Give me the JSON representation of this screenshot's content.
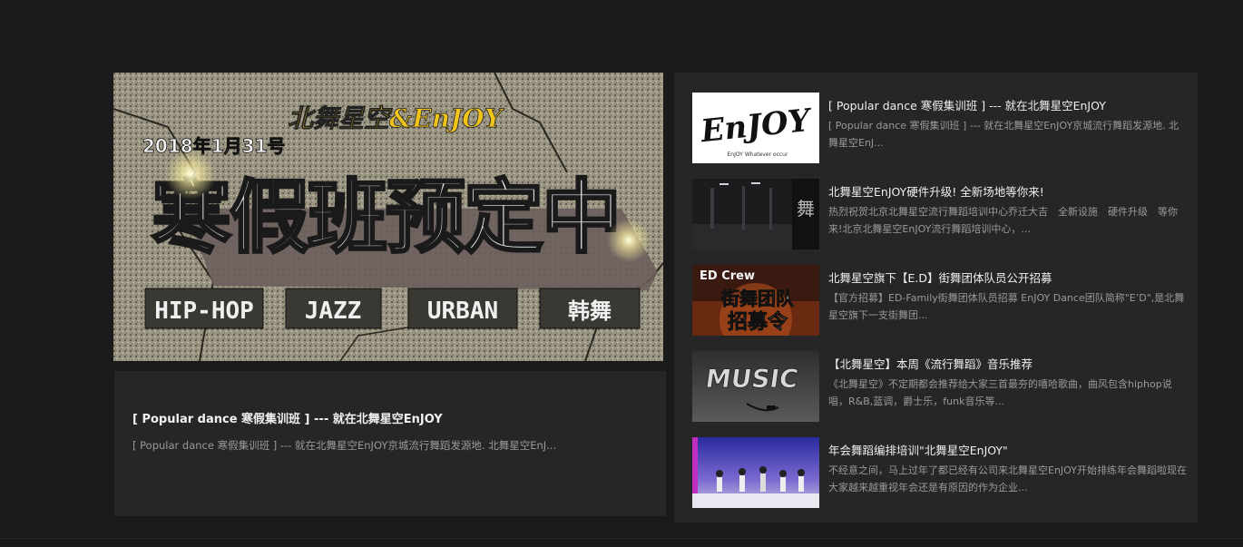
{
  "featured": {
    "banner": {
      "date": "2018年1月31号",
      "brand": "北舞星空&EnJOY",
      "headline": "寒假班预定中",
      "styles": [
        "HIP-HOP",
        "JAZZ",
        "URBAN",
        "韩舞"
      ]
    },
    "title": "[ Popular dance 寒假集训班 ] --- 就在北舞星空EnJOY",
    "desc": "[ Popular dance 寒假集训班 ] --- 就在北舞星空EnJOY京城流行舞蹈发源地. 北舞星空EnJ..."
  },
  "list": [
    {
      "title": "[ Popular dance 寒假集训班 ] --- 就在北舞星空EnJOY",
      "desc": "[ Popular dance 寒假集训班 ] --- 就在北舞星空EnJOY京城流行舞蹈发源地. 北舞星空EnJ...",
      "thumb": {
        "text": "EnJOY",
        "sub": "EnJOY Whatever occur"
      }
    },
    {
      "title": "北舞星空EnJOY硬件升级! 全新场地等你来!",
      "desc": "热烈祝贺北京北舞星空流行舞蹈培训中心乔迁大吉　全新设施　硬件升级　等你来!北京北舞星空EnJOY流行舞蹈培训中心，...",
      "thumb": {
        "text": ""
      }
    },
    {
      "title": "北舞星空旗下【E.D】街舞团体队员公开招募",
      "desc": "【官方招募】ED-Family街舞团体队员招募 EnJOY Dance团队简称\"E’D\",是北舞星空旗下一支街舞团...",
      "thumb": {
        "text": "ED Crew",
        "line1": "街舞团队",
        "line2": "招募令"
      }
    },
    {
      "title": "【北舞星空】本周《流行舞蹈》音乐推荐",
      "desc": "《北舞星空》不定期都会推荐给大家三首最夯的嘻哈歌曲，曲风包含hiphop说唱，R&B,蓝调，爵士乐，funk音乐等...",
      "thumb": {
        "text": "MUSIC"
      }
    },
    {
      "title": "年会舞蹈编排培训\"北舞星空EnJOY\"",
      "desc": "不经意之间，马上过年了都已经有公司来北舞星空EnJOY开始排练年会舞蹈啦现在大家越来越重视年会还是有原因的作为企业...",
      "thumb": {
        "text": ""
      }
    }
  ]
}
